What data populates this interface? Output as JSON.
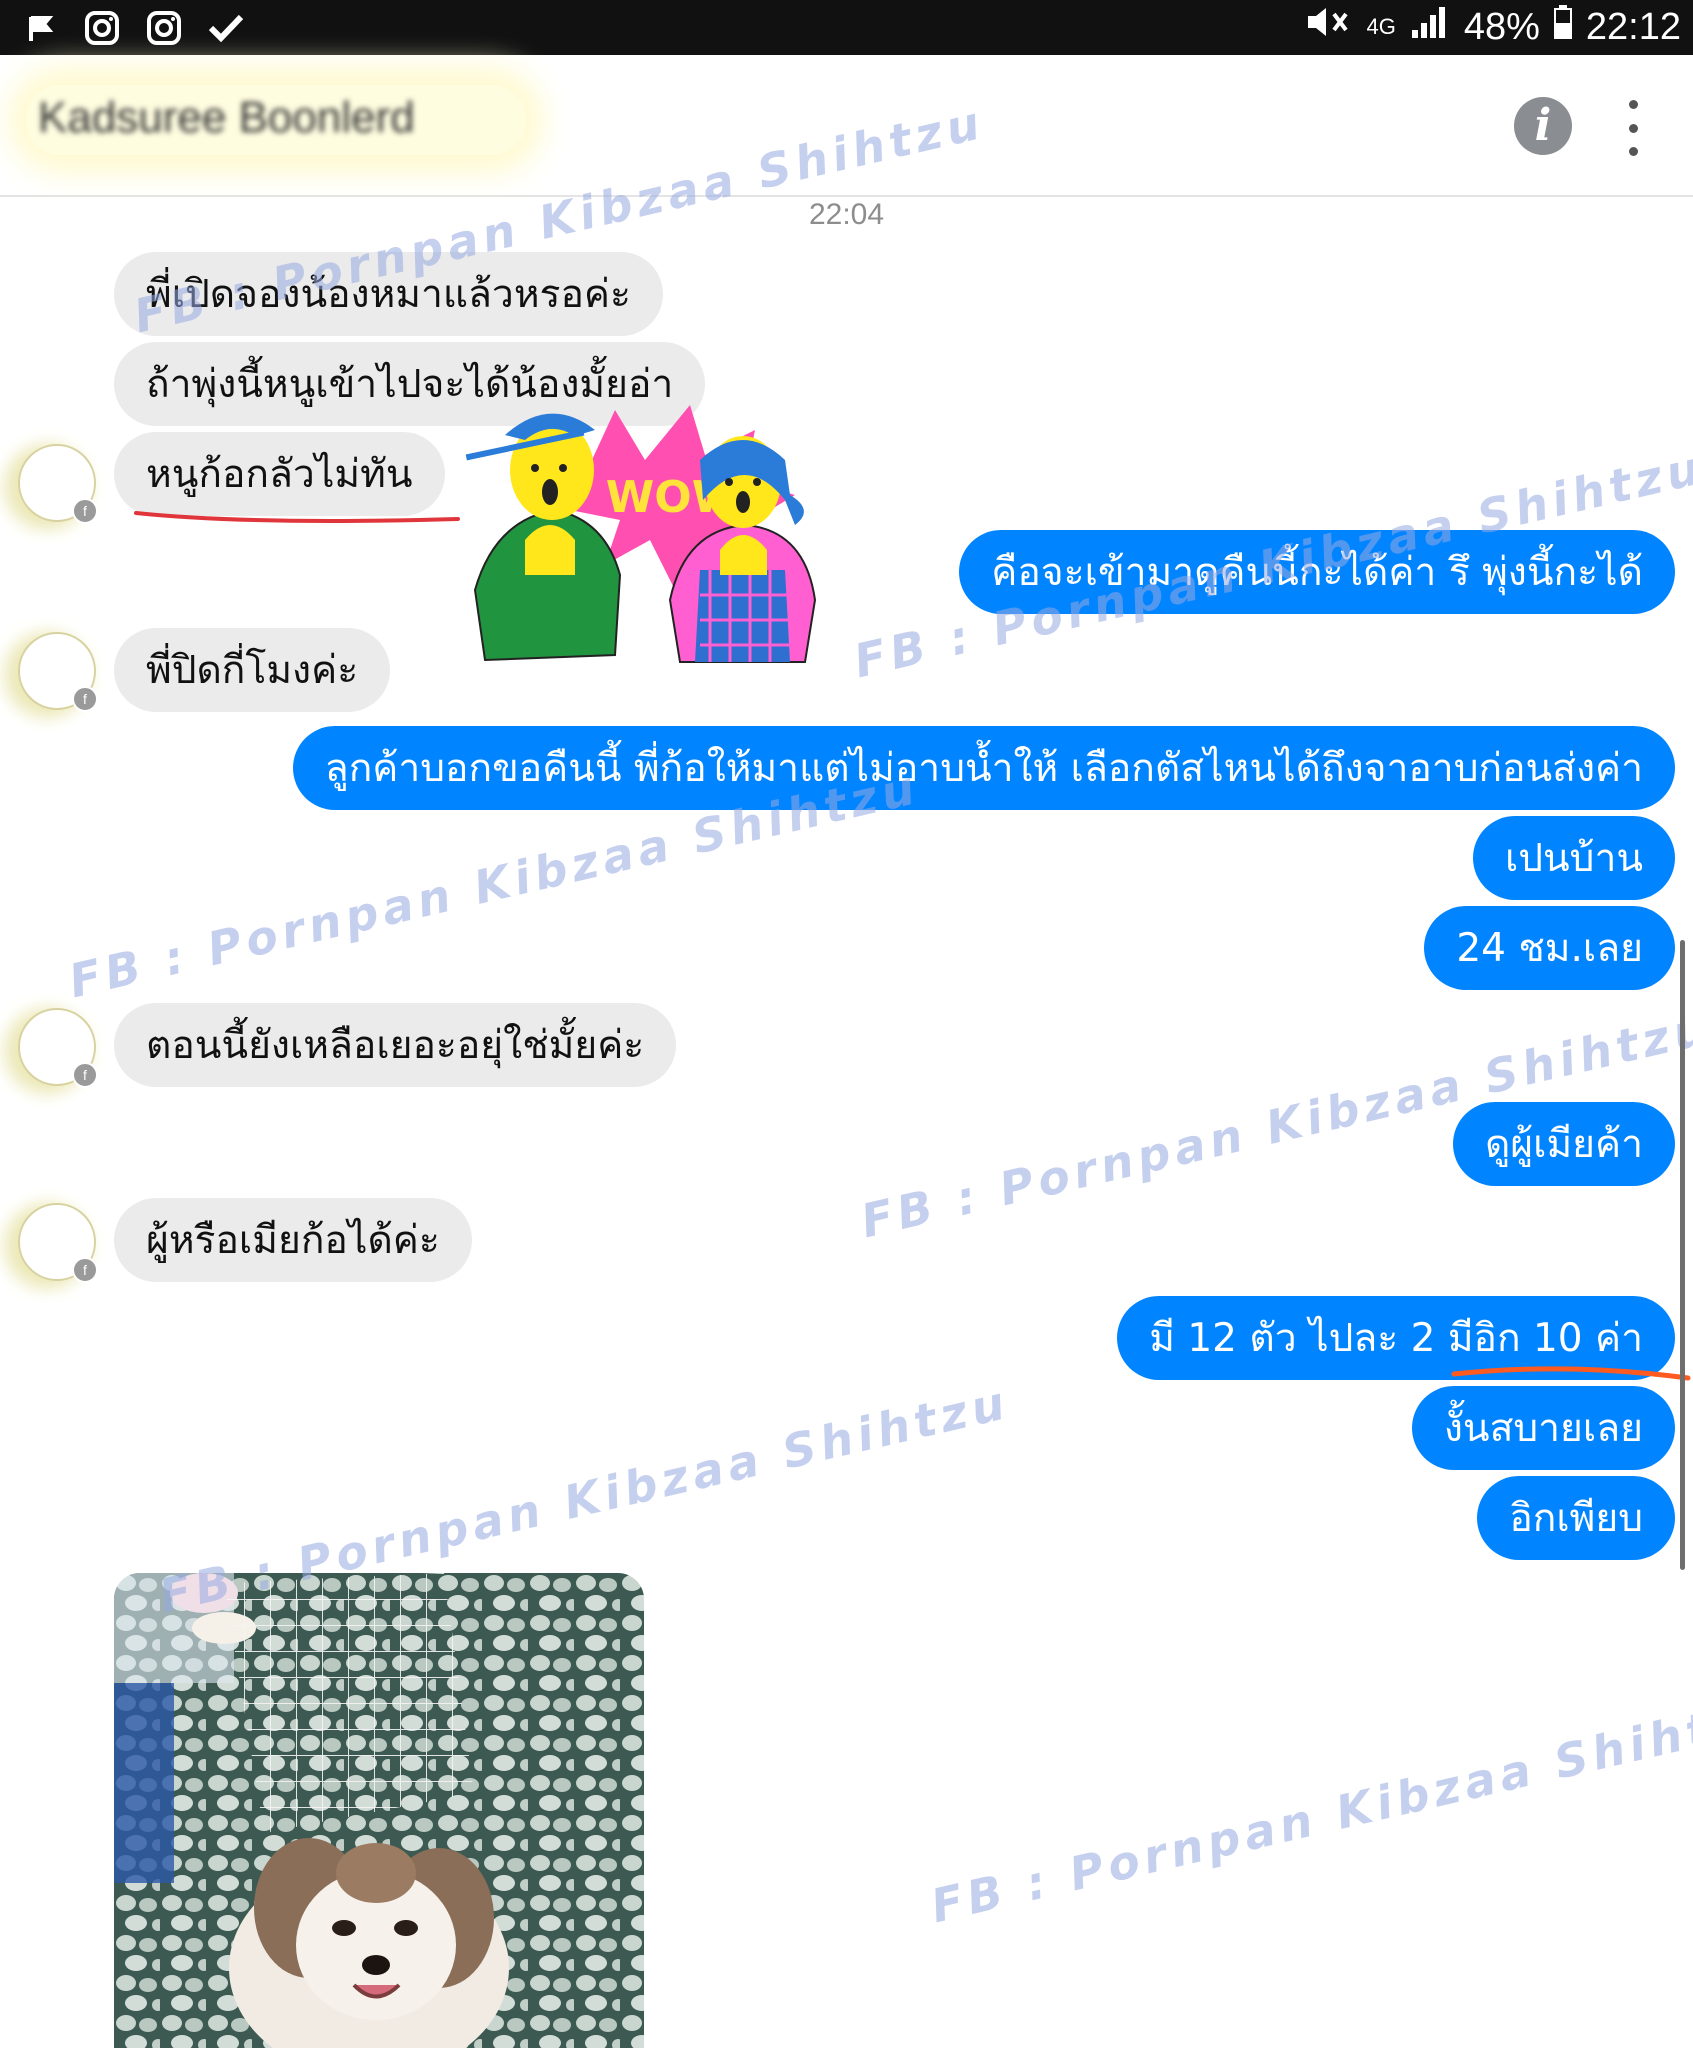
{
  "status_bar": {
    "network": "4G",
    "battery": "48%",
    "time": "22:12",
    "left_icons": [
      "flag-icon",
      "instagram-icon",
      "instagram-icon",
      "check-icon"
    ]
  },
  "header": {
    "contact_name": "Kadsuree Boonlerd"
  },
  "chat": {
    "timestamp": "22:04",
    "messages": [
      {
        "side": "in",
        "text": "พี่เปิดจองน้องหมาแล้วหรอค่ะ"
      },
      {
        "side": "in",
        "text": "ถ้าพุ่งนี้หนูเข้าไปจะได้น้องมั้ยอ่า"
      },
      {
        "side": "in",
        "text": "หนูก้อกลัวไม่ทัน"
      },
      {
        "side": "out",
        "text": "คือจะเข้ามาดูคืนนี้กะได้ค่า รึ พุ่งนี้กะได้"
      },
      {
        "side": "in",
        "text": "พี่ปิดกี่โมงค่ะ"
      },
      {
        "side": "out",
        "text": "ลูกค้าบอกขอคืนนี้ พี่ก้อให้มาแต่ไม่อาบน้ำให้ เลือกตัสไหนได้ถึงจาอาบก่อนส่งค่า"
      },
      {
        "side": "out",
        "text": "เปนบ้าน"
      },
      {
        "side": "out",
        "text": "24 ชม.เลย"
      },
      {
        "side": "in",
        "text": "ตอนนี้ยังเหลือเยอะอยุ่ใช่มั้ยค่ะ"
      },
      {
        "side": "out",
        "text": "ดูผู้เมียค้า"
      },
      {
        "side": "in",
        "text": "ผู้หรือเมียก้อได้ค่ะ"
      },
      {
        "side": "out",
        "text": "มี 12 ตัว ไปละ 2 มีอิก 10 ค่า"
      },
      {
        "side": "out",
        "text": "งั้นสบายเลย"
      },
      {
        "side": "out",
        "text": "อิกเพียบ"
      }
    ],
    "sticker_text": "WOW",
    "watermark": "FB : Pornpan Kibzaa Shihtzu"
  },
  "colors": {
    "outgoing_bubble": "#0084ff",
    "incoming_bubble": "#ebebeb",
    "underline": "#e0353a",
    "underline2": "#ff5a1f"
  }
}
